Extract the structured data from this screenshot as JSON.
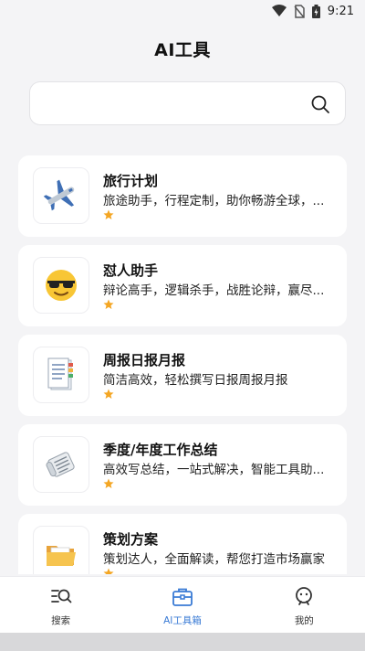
{
  "status_bar": {
    "time": "9:21"
  },
  "header": {
    "title": "AI工具"
  },
  "search": {
    "placeholder": ""
  },
  "tools": [
    {
      "name": "旅行计划",
      "description": "旅途助手，行程定制，助你畅游全球，...",
      "icon": "airplane-icon",
      "stars": 1
    },
    {
      "name": "怼人助手",
      "description": "辩论高手，逻辑杀手，战胜论辩，赢尽...",
      "icon": "sunglasses-face-icon",
      "stars": 1
    },
    {
      "name": "周报日报月报",
      "description": "简洁高效，轻松撰写日报周报月报",
      "icon": "document-icon",
      "stars": 1
    },
    {
      "name": "季度/年度工作总结",
      "description": "高效写总结，一站式解决，智能工具助...",
      "icon": "newspaper-icon",
      "stars": 1
    },
    {
      "name": "策划方案",
      "description": "策划达人，全面解读，帮您打造市场赢家",
      "icon": "folder-icon",
      "stars": 1
    }
  ],
  "tab_bar": {
    "active_color": "#3a7bd5",
    "items": [
      {
        "label": "搜索",
        "icon": "search-list-icon",
        "active": false
      },
      {
        "label": "AI工具箱",
        "icon": "toolbox-icon",
        "active": true
      },
      {
        "label": "我的",
        "icon": "profile-icon",
        "active": false
      }
    ]
  },
  "colors": {
    "star": "#f4a623",
    "background": "#f4f4f6"
  }
}
